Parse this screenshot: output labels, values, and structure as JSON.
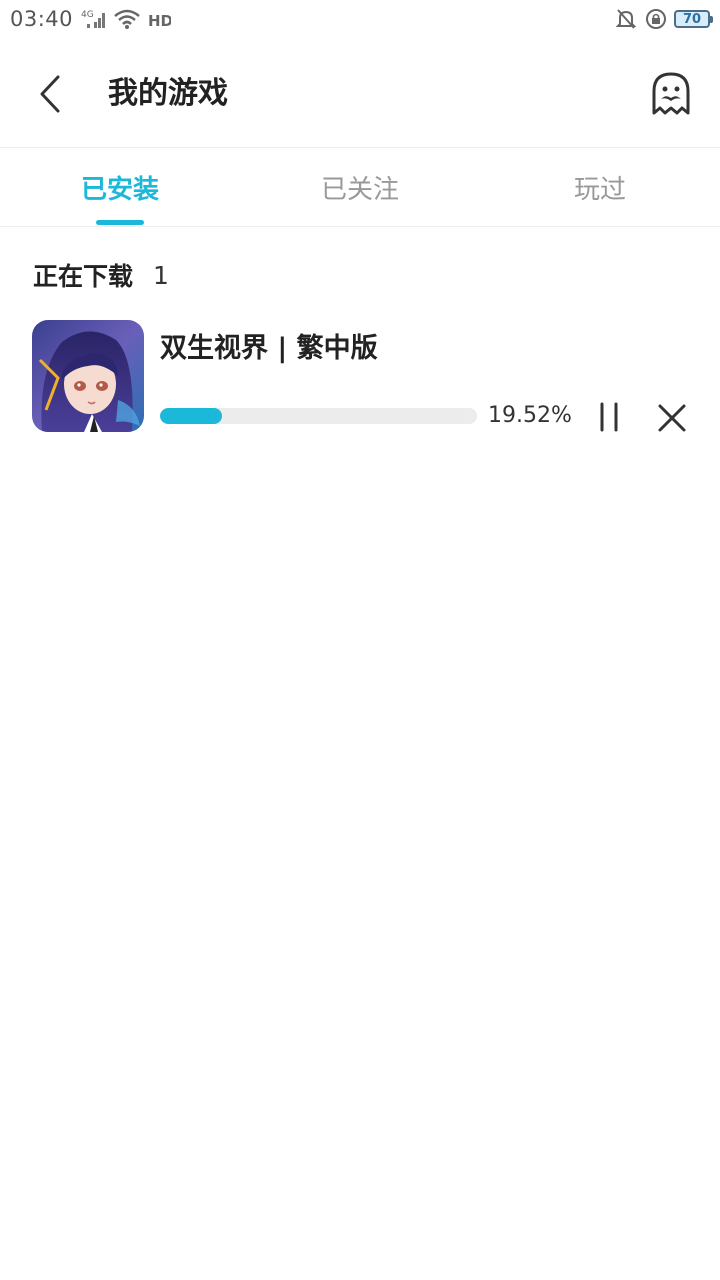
{
  "status_bar": {
    "time": "03:40",
    "network_label": "4G",
    "hd_label": "HD",
    "battery_level": "70"
  },
  "header": {
    "title": "我的游戏"
  },
  "tabs": [
    {
      "label": "已安装",
      "active": true
    },
    {
      "label": "已关注",
      "active": false
    },
    {
      "label": "玩过",
      "active": false
    }
  ],
  "section": {
    "title": "正在下载",
    "count": "1"
  },
  "downloads": [
    {
      "name": "双生视界 | 繁中版",
      "progress_text": "19.52%",
      "progress_fraction": 0.1952
    }
  ],
  "colors": {
    "accent": "#1cb8d9",
    "inactive_tab": "#999999",
    "track": "#ececec"
  },
  "icons": {
    "back": "chevron-left-icon",
    "profile": "ghost-mustache-icon",
    "pause": "pause-icon",
    "cancel": "close-icon"
  }
}
